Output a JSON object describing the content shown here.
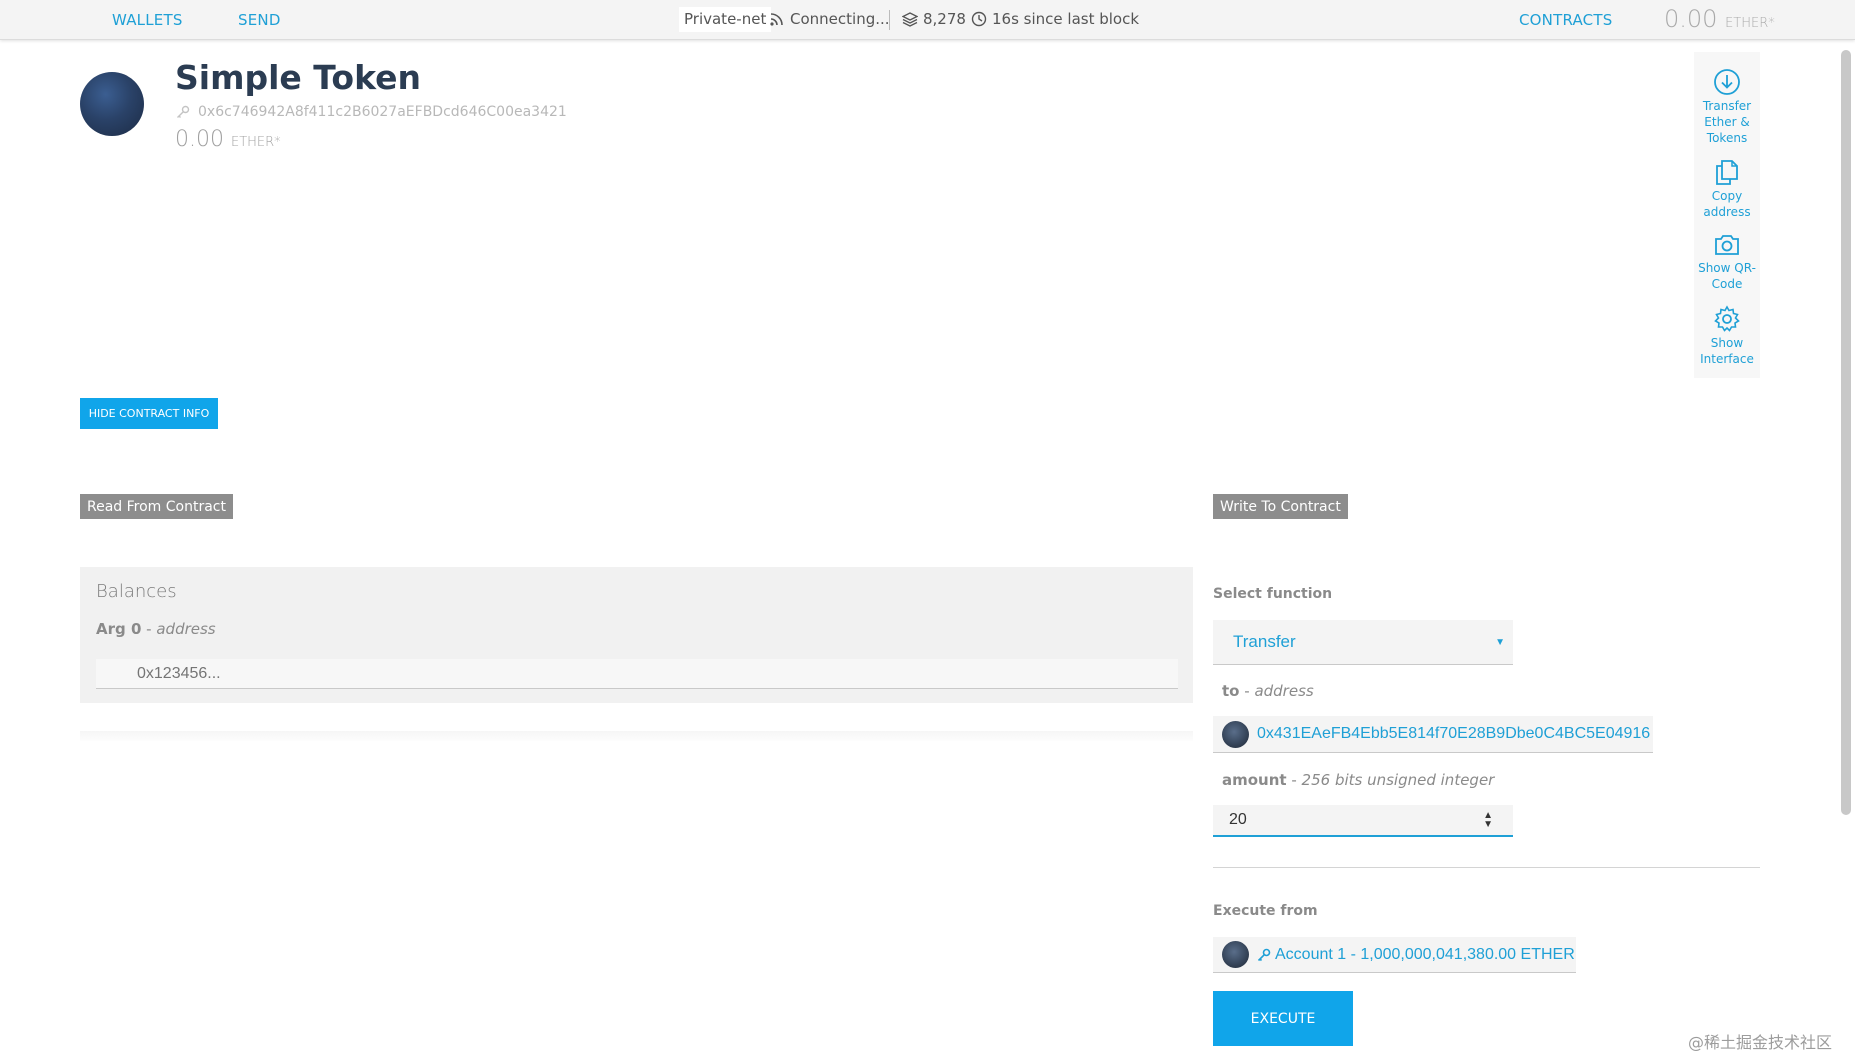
{
  "topbar": {
    "wallets": "WALLETS",
    "send": "SEND",
    "network": "Private-net",
    "connecting": "Connecting...",
    "block_number": "8,278",
    "last_block": "16s since last block",
    "contracts": "CONTRACTS",
    "balance_value": "0.00",
    "balance_unit": "ETHER*"
  },
  "contract": {
    "name": "Simple Token",
    "address": "0x6c746942A8f411c2B6027aEFBDcd646C00ea3421",
    "balance_value": "0.00",
    "balance_unit": "ETHER*"
  },
  "actions": [
    {
      "label": "Transfer Ether & Tokens",
      "icon": "download-circle-icon"
    },
    {
      "label": "Copy address",
      "icon": "copy-icon"
    },
    {
      "label": "Show QR-Code",
      "icon": "camera-icon"
    },
    {
      "label": "Show Interface",
      "icon": "gear-icon"
    }
  ],
  "buttons": {
    "hide_info": "HIDE CONTRACT INFO",
    "execute": "EXECUTE"
  },
  "read": {
    "tag": "Read From Contract",
    "panel_title": "Balances",
    "arg_name": "Arg 0",
    "arg_type": "address",
    "arg_placeholder": "0x123456..."
  },
  "write": {
    "tag": "Write To Contract",
    "select_label": "Select function",
    "selected_function": "Transfer",
    "to_name": "to",
    "to_type": "address",
    "to_value": "0x431EAeFB4Ebb5E814f70E28B9Dbe0C4BC5E04916",
    "amount_name": "amount",
    "amount_type": "256 bits unsigned integer",
    "amount_value": "20",
    "execute_label": "Execute from",
    "execute_account": "Account 1 - 1,000,000,041,380.00 ETHER"
  },
  "watermark": "@稀土掘金技术社区",
  "colors": {
    "accent": "#1fa0d6",
    "button": "#10a5ea",
    "tag": "#8d8d8d"
  }
}
